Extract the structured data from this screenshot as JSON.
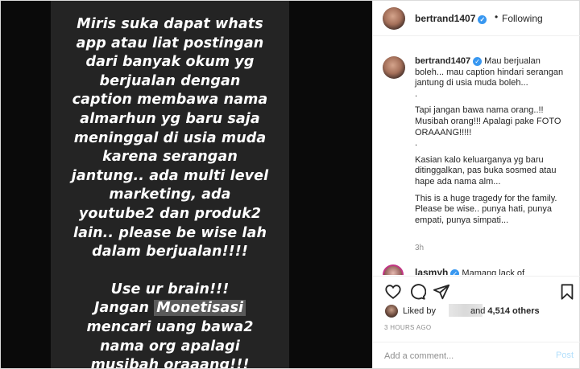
{
  "story": {
    "lines_1": [
      "Miris suka dapat whats",
      "app atau liat postingan",
      "dari banyak okum yg",
      "berjualan dengan",
      "caption membawa nama",
      "almarhun yg baru saja",
      "meninggal di usia muda",
      "karena serangan",
      "jantung.. ada multi level",
      "marketing, ada",
      "youtube2 dan produk2",
      "lain.. please be wise lah",
      "dalam berjualan!!!!"
    ],
    "line_brain": "Use ur brain!!!",
    "line_jangan": "Jangan",
    "line_monetisasi": "Monetisasi",
    "lines_2": [
      "mencari uang bawa2",
      "nama org apalagi",
      "musibah oraaang!!!"
    ]
  },
  "header": {
    "username": "bertrand1407",
    "verified_mark": "✓",
    "separator": "•",
    "follow_status": "Following"
  },
  "caption": {
    "username": "bertrand1407",
    "verified_mark": "✓",
    "first_text": "Mau berjualan",
    "lines": [
      "boleh... mau caption hindari serangan",
      "jantung di usia muda boleh...",
      ".",
      "Tapi jangan bawa nama orang..!!",
      "Musibah orang!!! Apalagi pake FOTO",
      "ORAAANG!!!!!",
      ".",
      "Kasian kalo keluarganya yg baru",
      "ditinggalkan, pas buka sosmed atau",
      "hape ada nama alm...",
      "This is a huge tragedy for the family.",
      "Please be wise.. punya hati, punya",
      "empati, punya simpati..."
    ],
    "time": "3h"
  },
  "next_comment": {
    "username": "lasmyh",
    "verified_mark": "✓",
    "text": "Mamang lack of"
  },
  "actions": {
    "like_icon": "heart-icon",
    "comment_icon": "comment-icon",
    "share_icon": "share-icon",
    "save_icon": "bookmark-icon"
  },
  "likes": {
    "liked_by": "Liked by",
    "and": "and",
    "count": "4,514 others"
  },
  "timestamp": "3 HOURS AGO",
  "comment_box": {
    "placeholder": "Add a comment...",
    "post_label": "Post"
  },
  "colors": {
    "accent_blue": "#3897f0",
    "post_disabled": "#b2dffc",
    "story_bg": "#242424"
  }
}
